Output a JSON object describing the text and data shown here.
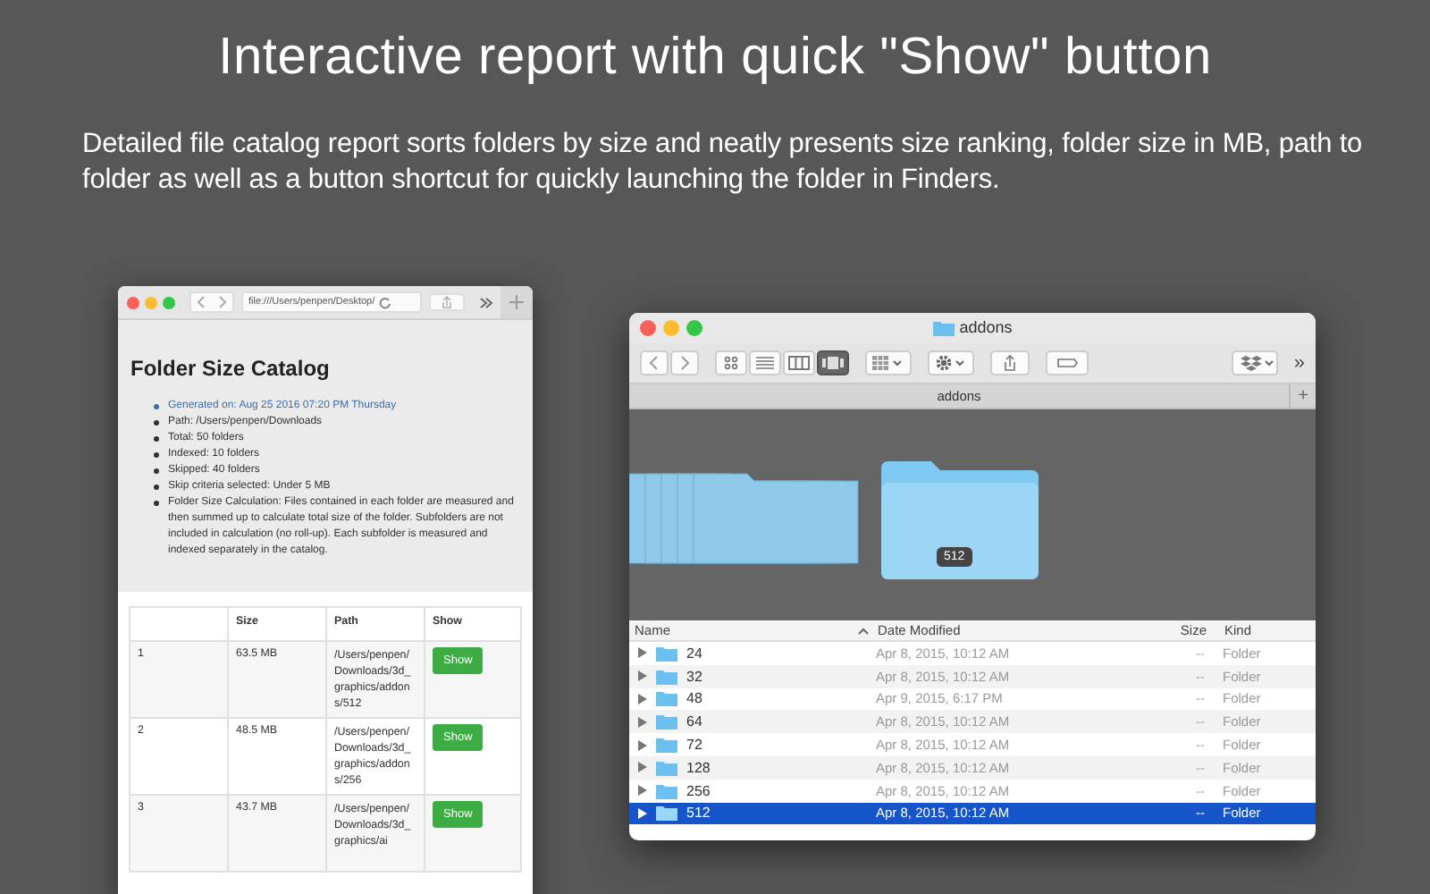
{
  "headline": "Interactive report with quick \"Show\" button",
  "description": "Detailed file catalog report sorts folders by size and neatly presents size ranking, folder size in MB, path to folder as well as a button shortcut for quickly launching the folder in Finders.",
  "browser": {
    "url": "file:///Users/penpen/Desktop/",
    "report": {
      "title": "Folder Size Catalog",
      "items": [
        {
          "text": "Generated on: Aug 25 2016 07:20 PM Thursday",
          "kind": "link"
        },
        {
          "text": "Path: /Users/penpen/Downloads",
          "kind": "plain"
        },
        {
          "text": "Total: 50 folders",
          "kind": "plain"
        },
        {
          "text": "Indexed: 10 folders",
          "kind": "plain"
        },
        {
          "text": "Skipped: 40 folders",
          "kind": "plain"
        },
        {
          "text": "Skip criteria selected: Under 5 MB",
          "kind": "plain"
        },
        {
          "text": "Folder Size Calculation: Files contained in each folder are measured and then summed up to calculate total size of the folder. Subfolders are not included in calculation (no roll-up). Each subfolder is measured and indexed separately in the catalog.",
          "kind": "plain"
        }
      ],
      "table": {
        "columns": [
          "Size",
          "Path",
          "Show"
        ],
        "rows": [
          {
            "rank": "1",
            "size": "63.5 MB",
            "path": "/Users/penpen/Downloads/3d_graphics/addons/512",
            "button": "Show"
          },
          {
            "rank": "2",
            "size": "48.5 MB",
            "path": "/Users/penpen/Downloads/3d_graphics/addons/256",
            "button": "Show"
          },
          {
            "rank": "3",
            "size": "43.7 MB",
            "path": "/Users/penpen/Downloads/3d_graphics/ai",
            "button": "Show"
          }
        ]
      }
    }
  },
  "finder": {
    "title": "addons",
    "tab": "addons",
    "more": "»",
    "tab_add": "+",
    "cover_label": "512",
    "columns": [
      "Name",
      "Date Modified",
      "Size",
      "Kind"
    ],
    "rows": [
      {
        "name": "24",
        "date": "Apr 8, 2015, 10:12 AM",
        "size": "--",
        "kind": "Folder",
        "selected": false
      },
      {
        "name": "32",
        "date": "Apr 8, 2015, 10:12 AM",
        "size": "--",
        "kind": "Folder",
        "selected": false
      },
      {
        "name": "48",
        "date": "Apr 9, 2015, 6:17 PM",
        "size": "--",
        "kind": "Folder",
        "selected": false
      },
      {
        "name": "64",
        "date": "Apr 8, 2015, 10:12 AM",
        "size": "--",
        "kind": "Folder",
        "selected": false
      },
      {
        "name": "72",
        "date": "Apr 8, 2015, 10:12 AM",
        "size": "--",
        "kind": "Folder",
        "selected": false
      },
      {
        "name": "128",
        "date": "Apr 8, 2015, 10:12 AM",
        "size": "--",
        "kind": "Folder",
        "selected": false
      },
      {
        "name": "256",
        "date": "Apr 8, 2015, 10:12 AM",
        "size": "--",
        "kind": "Folder",
        "selected": false
      },
      {
        "name": "512",
        "date": "Apr 8, 2015, 10:12 AM",
        "size": "--",
        "kind": "Folder",
        "selected": true
      }
    ]
  }
}
